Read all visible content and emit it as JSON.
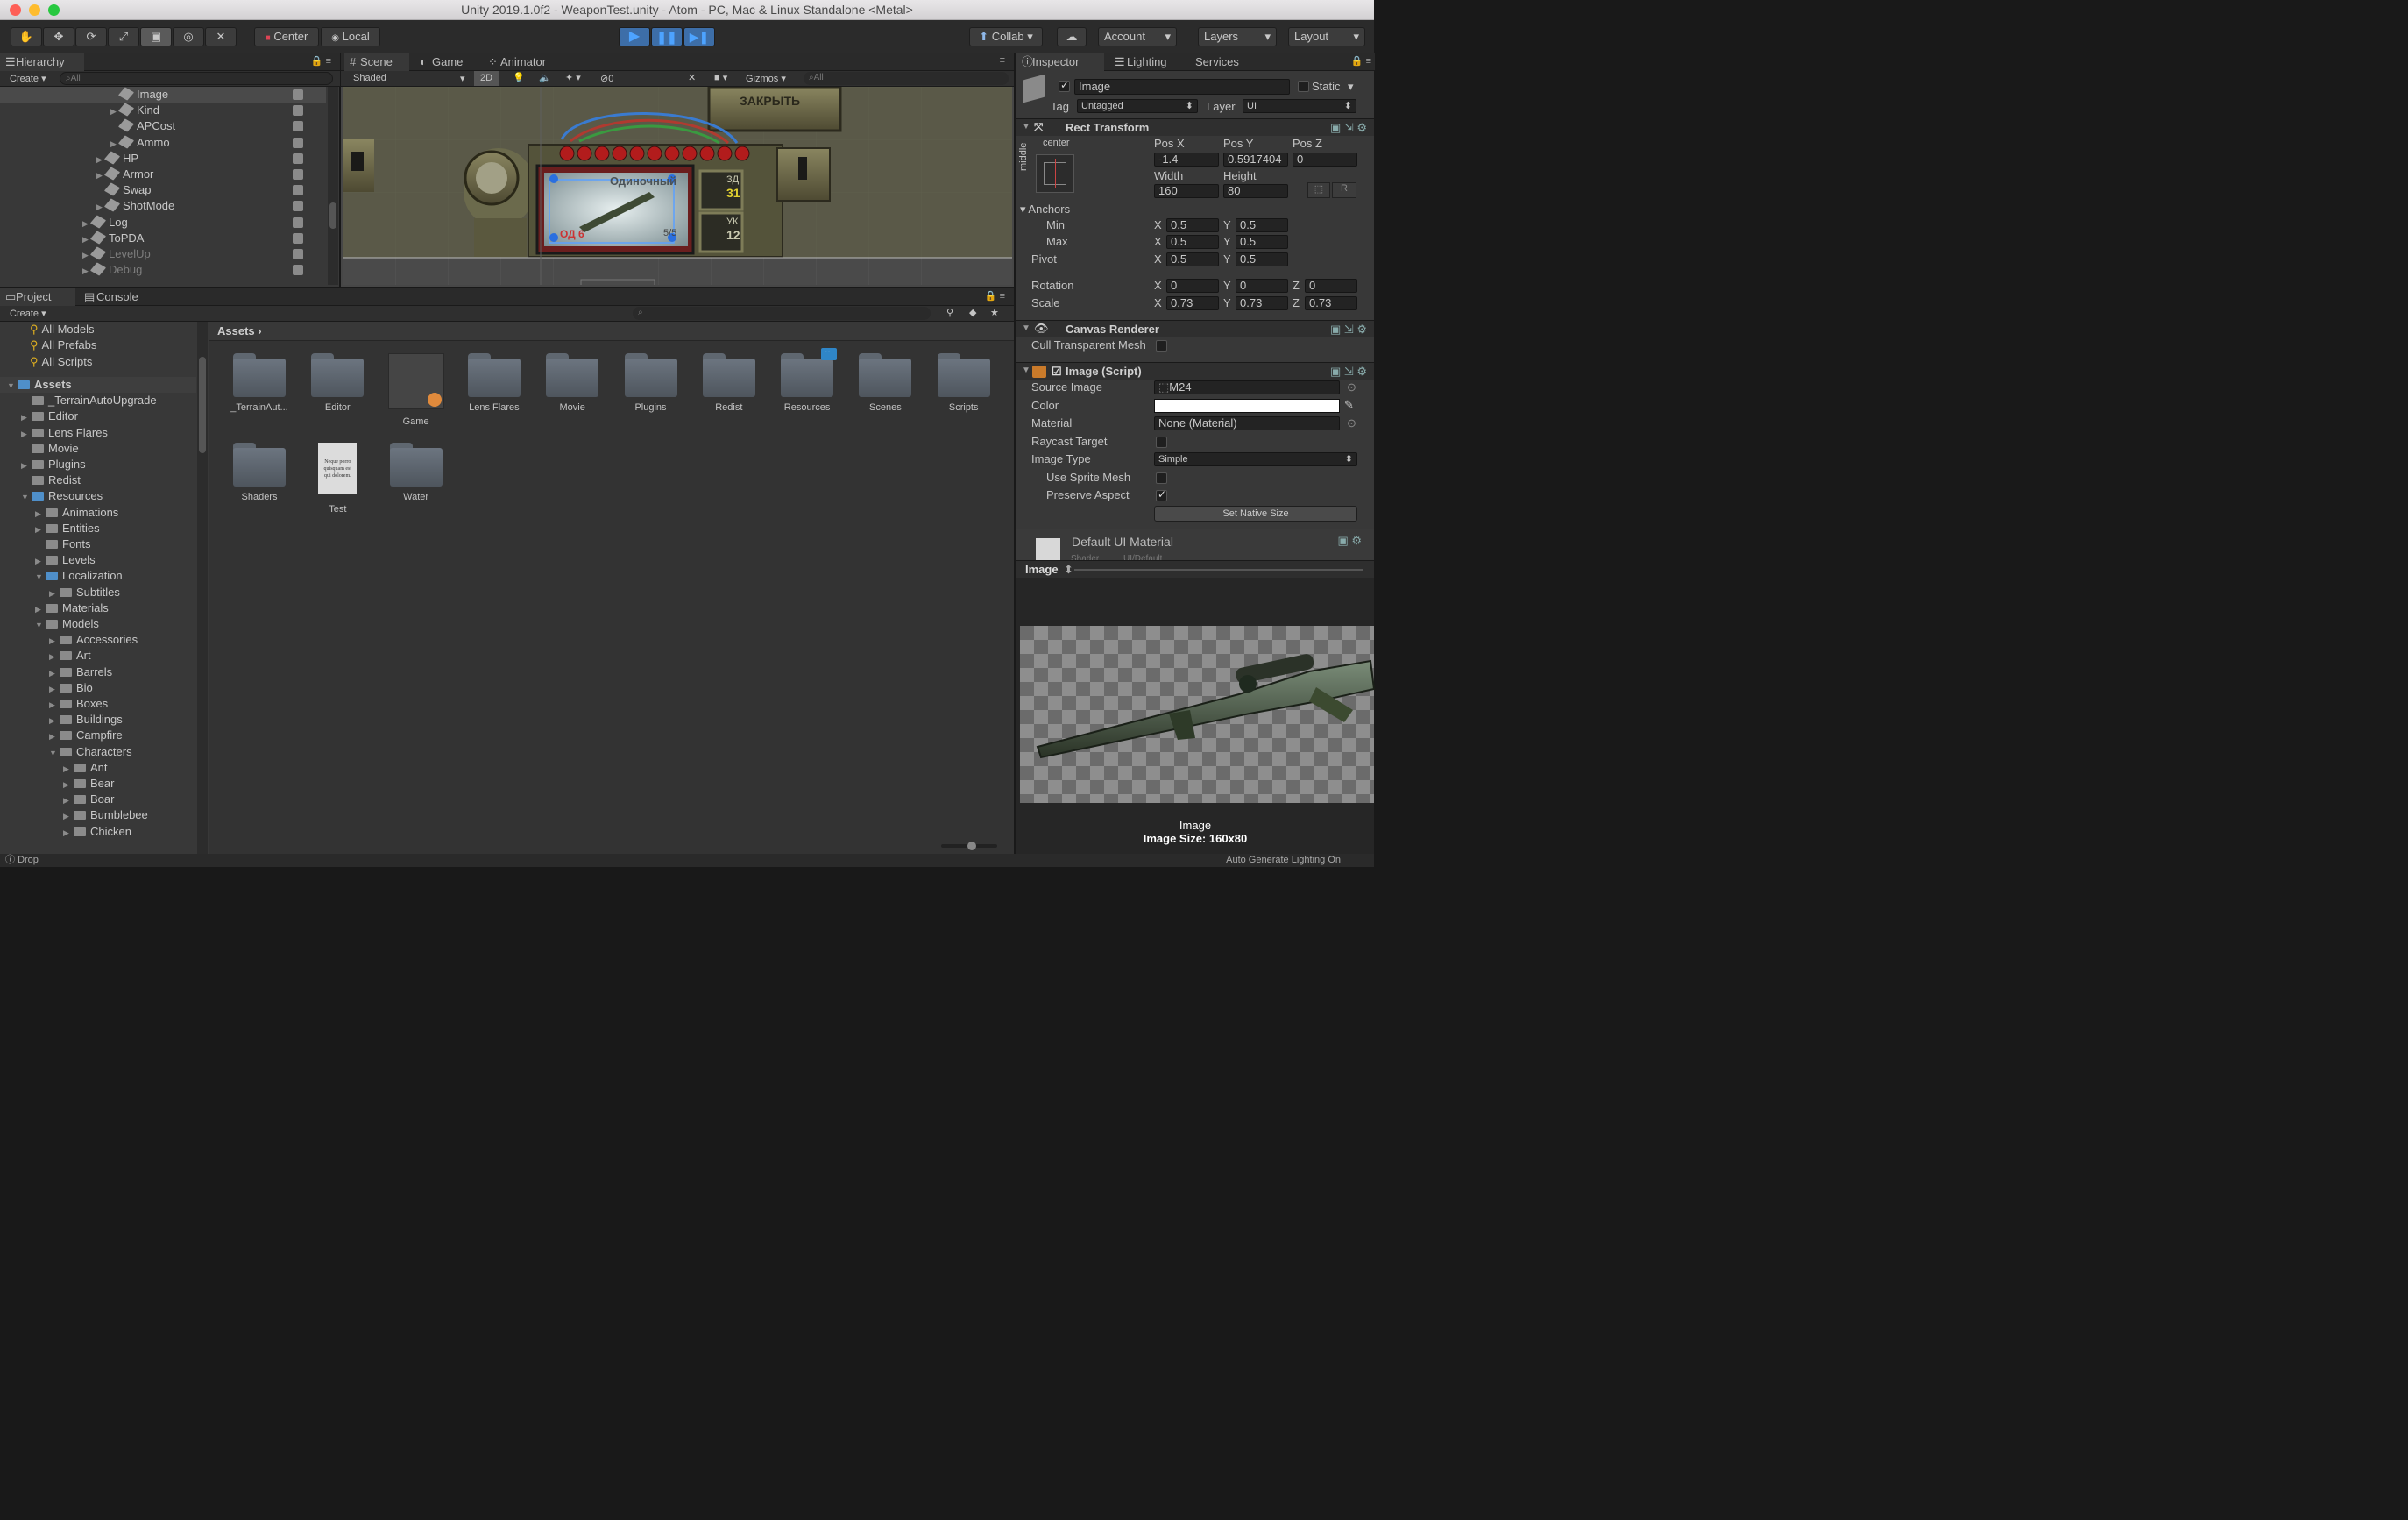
{
  "window": {
    "title": "Unity 2019.1.0f2 - WeaponTest.unity - Atom - PC, Mac & Linux Standalone <Metal>"
  },
  "toolbar": {
    "center": "Center",
    "local": "Local",
    "collab": "Collab",
    "account": "Account",
    "layers": "Layers",
    "layout": "Layout"
  },
  "hierarchy": {
    "tab": "Hierarchy",
    "create": "Create",
    "search_placeholder": "All",
    "items": [
      {
        "label": "Image",
        "depth": 4,
        "selected": true
      },
      {
        "label": "Kind",
        "depth": 4,
        "arrow": true
      },
      {
        "label": "APCost",
        "depth": 4
      },
      {
        "label": "Ammo",
        "depth": 4,
        "arrow": true
      },
      {
        "label": "HP",
        "depth": 3,
        "arrow": true
      },
      {
        "label": "Armor",
        "depth": 3,
        "arrow": true
      },
      {
        "label": "Swap",
        "depth": 3
      },
      {
        "label": "ShotMode",
        "depth": 3,
        "arrow": true
      },
      {
        "label": "Log",
        "depth": 2,
        "arrow": true
      },
      {
        "label": "ToPDA",
        "depth": 2,
        "arrow": true
      },
      {
        "label": "LevelUp",
        "depth": 2,
        "arrow": true,
        "dim": true
      },
      {
        "label": "Debug",
        "depth": 2,
        "arrow": true,
        "dim": true
      }
    ]
  },
  "scene": {
    "tabs": [
      "Scene",
      "Game",
      "Animator"
    ],
    "shading": "Shaded",
    "mode_2d": "2D",
    "gizmos": "Gizmos",
    "search_placeholder": "All",
    "hidden_count": "0",
    "overlay": {
      "close": "ЗАКРЫТЬ",
      "mode": "Одиночный",
      "zd_label": "ЗД",
      "zd_value": "31",
      "uk_label": "УК",
      "uk_value": "12",
      "od": "ОД 6",
      "hp": "5/5"
    }
  },
  "project": {
    "tabs": [
      "Project",
      "Console"
    ],
    "create": "Create",
    "favorites": [
      "All Models",
      "All Prefabs",
      "All Scripts"
    ],
    "tree": [
      {
        "label": "Assets",
        "depth": 0,
        "bold": true,
        "open": true
      },
      {
        "label": "_TerrainAutoUpgrade",
        "depth": 1
      },
      {
        "label": "Editor",
        "depth": 1,
        "arrow": true
      },
      {
        "label": "Lens Flares",
        "depth": 1,
        "arrow": true
      },
      {
        "label": "Movie",
        "depth": 1
      },
      {
        "label": "Plugins",
        "depth": 1,
        "arrow": true
      },
      {
        "label": "Redist",
        "depth": 1
      },
      {
        "label": "Resources",
        "depth": 1,
        "open": true
      },
      {
        "label": "Animations",
        "depth": 2,
        "arrow": true
      },
      {
        "label": "Entities",
        "depth": 2,
        "arrow": true
      },
      {
        "label": "Fonts",
        "depth": 2
      },
      {
        "label": "Levels",
        "depth": 2,
        "arrow": true
      },
      {
        "label": "Localization",
        "depth": 2,
        "open": true
      },
      {
        "label": "Subtitles",
        "depth": 3,
        "arrow": true
      },
      {
        "label": "Materials",
        "depth": 2,
        "arrow": true
      },
      {
        "label": "Models",
        "depth": 2,
        "open": true
      },
      {
        "label": "Accessories",
        "depth": 3,
        "arrow": true
      },
      {
        "label": "Art",
        "depth": 3,
        "arrow": true
      },
      {
        "label": "Barrels",
        "depth": 3,
        "arrow": true
      },
      {
        "label": "Bio",
        "depth": 3,
        "arrow": true
      },
      {
        "label": "Boxes",
        "depth": 3,
        "arrow": true
      },
      {
        "label": "Buildings",
        "depth": 3,
        "arrow": true
      },
      {
        "label": "Campfire",
        "depth": 3,
        "arrow": true
      },
      {
        "label": "Characters",
        "depth": 3,
        "open": true
      },
      {
        "label": "Ant",
        "depth": 4,
        "arrow": true
      },
      {
        "label": "Bear",
        "depth": 4,
        "arrow": true
      },
      {
        "label": "Boar",
        "depth": 4,
        "arrow": true
      },
      {
        "label": "Bumblebee",
        "depth": 4,
        "arrow": true
      },
      {
        "label": "Chicken",
        "depth": 4,
        "arrow": true
      }
    ],
    "breadcrumb": "Assets",
    "assets_row1": [
      "_TerrainAut...",
      "Editor",
      "Game",
      "Lens Flares",
      "Movie",
      "Plugins",
      "Redist",
      "Resources",
      "Scenes",
      "Scripts"
    ],
    "assets_row2": [
      "Shaders",
      "Test",
      "Water"
    ],
    "test_doc_text": "Neque porro quisquam est qui dolorem."
  },
  "status": {
    "left": "Drop",
    "right": "Auto Generate Lighting On"
  },
  "inspector": {
    "tabs": [
      "Inspector",
      "Lighting",
      "Services"
    ],
    "object_name": "Image",
    "static": "Static",
    "tag_label": "Tag",
    "tag": "Untagged",
    "layer_label": "Layer",
    "layer": "UI",
    "rect": {
      "title": "Rect Transform",
      "anchor_h": "center",
      "anchor_v": "middle",
      "posx_label": "Pos X",
      "posy_label": "Pos Y",
      "posz_label": "Pos Z",
      "posx": "-1.4",
      "posy": "0.5917404",
      "posz": "0",
      "width_label": "Width",
      "height_label": "Height",
      "width": "160",
      "height": "80",
      "r": "R",
      "anchors_label": "Anchors",
      "min_label": "Min",
      "max_label": "Max",
      "min_x": "0.5",
      "min_y": "0.5",
      "max_x": "0.5",
      "max_y": "0.5",
      "pivot_label": "Pivot",
      "pivot_x": "0.5",
      "pivot_y": "0.5",
      "rotation_label": "Rotation",
      "rot_x": "0",
      "rot_y": "0",
      "rot_z": "0",
      "scale_label": "Scale",
      "scale_x": "0.73",
      "scale_y": "0.73",
      "scale_z": "0.73",
      "x": "X",
      "y": "Y",
      "z": "Z"
    },
    "canvas_renderer": {
      "title": "Canvas Renderer",
      "cull_label": "Cull Transparent Mesh"
    },
    "image": {
      "title": "Image (Script)",
      "source_label": "Source Image",
      "source": "M24",
      "color_label": "Color",
      "color": "#ffffff",
      "material_label": "Material",
      "material": "None (Material)",
      "raycast_label": "Raycast Target",
      "type_label": "Image Type",
      "type": "Simple",
      "sprite_mesh_label": "Use Sprite Mesh",
      "preserve_label": "Preserve Aspect",
      "native_btn": "Set Native Size"
    },
    "material": {
      "title": "Default UI Material",
      "shader_label": "Shader",
      "shader": "UI/Default"
    },
    "preview": {
      "header": "Image",
      "caption1": "Image",
      "caption2": "Image Size: 160x80"
    }
  }
}
